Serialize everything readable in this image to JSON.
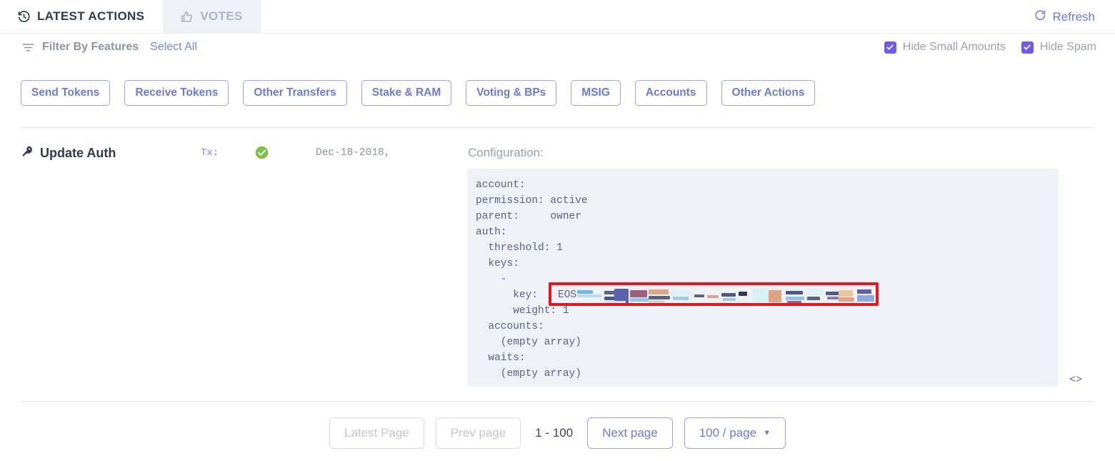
{
  "tabs": [
    {
      "label": "LATEST ACTIONS",
      "icon": "history-icon",
      "active": true
    },
    {
      "label": "VOTES",
      "icon": "thumbs-up-icon",
      "active": false
    }
  ],
  "refresh": {
    "label": "Refresh",
    "icon": "refresh-icon"
  },
  "filter": {
    "icon": "filter-icon",
    "label": "Filter By Features",
    "select_all": "Select All",
    "chips": [
      "Send Tokens",
      "Receive Tokens",
      "Other Transfers",
      "Stake & RAM",
      "Voting & BPs",
      "MSIG",
      "Accounts",
      "Other Actions"
    ],
    "checkboxes": [
      {
        "label": "Hide Small Amounts",
        "checked": true
      },
      {
        "label": "Hide Spam",
        "checked": true
      }
    ]
  },
  "action": {
    "icon": "key-icon",
    "title": "Update Auth",
    "tx_label": "Tx:",
    "tx_value": "",
    "status": "success",
    "date": "Dec-18-2018,",
    "configuration_label": "Configuration:",
    "configuration": "account:\npermission: active\nparent:     owner\nauth:\n  threshold: 1\n  keys:\n    -\n      key:   \n      weight: 1\n  accounts:\n    (empty array)\n  waits:\n    (empty array)",
    "key_prefix": "EOS",
    "key_redacted": true,
    "code_toggle": "<>"
  },
  "pagination": {
    "latest_page": "Latest Page",
    "prev_page": "Prev page",
    "range": "1 - 100",
    "next_page": "Next page",
    "page_size": "100 / page"
  },
  "colors": {
    "accent": "#6c7ae0",
    "checkbox": "#6c5ce7",
    "success": "#7ac142",
    "redaction_border": "#e8161b",
    "panel_bg": "#eef1f6",
    "text_dark": "#2f3a56",
    "text_muted": "#9aa1b4"
  }
}
